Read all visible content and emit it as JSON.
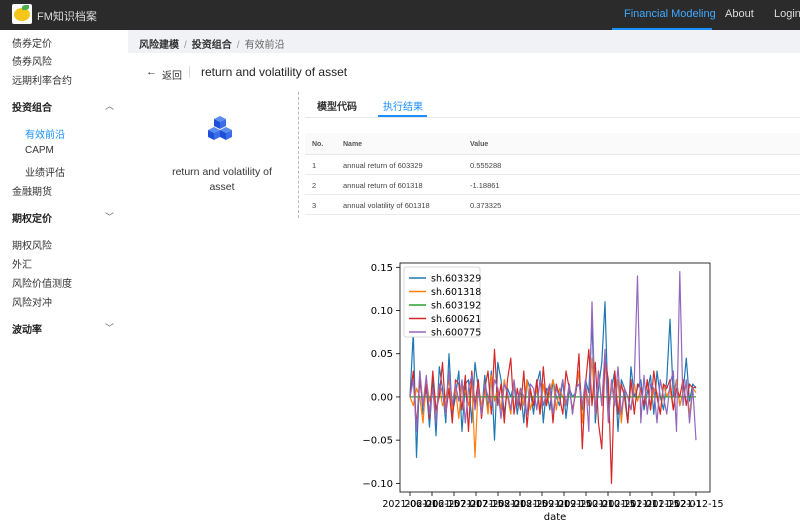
{
  "header": {
    "brand": "FM知识档案",
    "nav": [
      "Financial Modeling",
      "About",
      "Login"
    ],
    "active_nav": "Financial Modeling"
  },
  "sidebar": {
    "items_top": [
      "债券定价",
      "债券风险",
      "远期利率合约"
    ],
    "group_portfolio": "投资组合",
    "portfolio_children": [
      "有效前沿",
      "CAPM",
      "业绩评估"
    ],
    "active_child": "有效前沿",
    "item_futures": "金融期货",
    "group_options": "期权定价",
    "items_mid": [
      "期权风险",
      "外汇",
      "风险价值测度",
      "风险对冲"
    ],
    "group_vol": "波动率"
  },
  "breadcrumb": [
    "风险建模",
    "投资组合",
    "有效前沿"
  ],
  "page": {
    "back_label": "返回",
    "title": "return and volatility of asset",
    "model_name": "return and volatility of asset"
  },
  "tabs": [
    "模型代码",
    "执行结果"
  ],
  "active_tab": "执行结果",
  "table": {
    "headers": [
      "No.",
      "Name",
      "Value"
    ],
    "rows": [
      {
        "no": "1",
        "name": "annual return of 603329",
        "value": "0.555288"
      },
      {
        "no": "2",
        "name": "annual return of 601318",
        "value": "-1.18861"
      },
      {
        "no": "3",
        "name": "annual volatility of 601318",
        "value": "0.373325"
      }
    ]
  },
  "chart_data": {
    "type": "line",
    "xlabel": "date",
    "ylabel": "",
    "x_ticks": [
      "2021-06-01",
      "2021-06-15",
      "2021-07-01",
      "2021-07-15",
      "2021-08-01",
      "2021-08-15",
      "2021-09-01",
      "2021-09-15",
      "2021-10-01",
      "2021-10-15",
      "2021-11-01",
      "2021-11-15",
      "2021-12-01",
      "2021-12-15"
    ],
    "x_tick_labels_visible": [
      "2021-06-01",
      "2021-06-15",
      "2021-07-01",
      "2021-07-15",
      "2021-08-01",
      "2021-08-15",
      "2021-09-01",
      "2021-09-15",
      "2021-10-01",
      "2021-10-15",
      "2021-11-01",
      "2021-11-15",
      "2021-12-01",
      "2021-12-15"
    ],
    "x_tick_labels": [
      "2021-06-01",
      "2021-06-15",
      "2021-07-01",
      "2021-07-15",
      "2021-08-01",
      "2021-08-15",
      "2021-09-01",
      "2021-09-15",
      "2021-10-01",
      "2021-10-15",
      "2021-11-01",
      "2021-11-15",
      "2021-12-01",
      "2021-12-15"
    ],
    "x_ticks_rendered": [
      "2021-06-0",
      "2021-06-1",
      "2021-07-0",
      "2021-07-1",
      "2021-08-0",
      "2021-08-1",
      "2021-09-0",
      "2021-09-1",
      "2021-10-0",
      "2021-10-1",
      "2021-11-0",
      "2021-11-1",
      "2021-12-0",
      "2021-12-1"
    ],
    "x_tick_text": [
      "2021-06-01",
      "2021-06-15",
      "2021-07-01",
      "2021-07-15",
      "2021-08-01",
      "2021-08-15",
      "2021-09-01",
      "2021-09-15",
      "2021-10-01",
      "2021-10-15",
      "2021-11-01",
      "2021-11-15",
      "2021-12-01",
      "2021-12-15"
    ],
    "xtick_labels_shown": [
      "2021-06-01",
      "2021-06-15",
      "2021-07-01",
      "2021-07-15",
      "2021-08-01",
      "2021-08-15",
      "2021-09-01",
      "2021-09-15",
      "2021-10-01",
      "2021-10-15",
      "2021-11-01",
      "2021-11-15",
      "2021-12-01",
      "2021-12-15"
    ],
    "ylim": [
      -0.11,
      0.155
    ],
    "y_ticks": [
      -0.1,
      -0.05,
      0.0,
      0.05,
      0.1,
      0.15
    ],
    "y_tick_labels": [
      "−0.10",
      "−0.05",
      "0.00",
      "0.05",
      "0.10",
      "0.15"
    ],
    "legend_position": "top-left",
    "grid": false,
    "series": [
      {
        "name": "sh.603329",
        "color": "#1f77b4",
        "values": [
          0.0,
          0.075,
          -0.07,
          0.03,
          -0.02,
          0.012,
          -0.035,
          0.02,
          -0.045,
          0.035,
          0.01,
          -0.03,
          0.05,
          -0.02,
          0.0,
          0.03,
          -0.04,
          0.015,
          0.02,
          -0.03,
          0.04,
          0.01,
          -0.02,
          0.025,
          -0.015,
          0.03,
          -0.05,
          0.04,
          0.02,
          -0.02,
          0.01,
          0.0,
          0.015,
          -0.02,
          0.01,
          -0.03,
          0.02,
          0.01,
          -0.02,
          0.015,
          0.03,
          -0.03,
          0.01,
          -0.015,
          0.02,
          0.0,
          -0.01,
          0.02,
          -0.025,
          0.01,
          0.0,
          0.005,
          0.03,
          -0.015,
          0.02,
          0.005,
          0.085,
          -0.03,
          0.01,
          0.04,
          0.11,
          -0.02,
          0.01,
          0.03,
          -0.04,
          0.02,
          0.01,
          -0.03,
          0.035,
          0.0,
          0.01,
          0.02,
          -0.015,
          0.005,
          0.025,
          -0.02,
          0.03,
          0.0,
          -0.015,
          0.02,
          0.09,
          0.0,
          0.02,
          -0.01,
          0.005,
          0.045,
          -0.005,
          0.015,
          0.01
        ]
      },
      {
        "name": "sh.601318",
        "color": "#ff7f0e",
        "values": [
          0.0,
          -0.01,
          0.01,
          0.0,
          -0.03,
          0.02,
          -0.005,
          0.01,
          -0.02,
          0.015,
          -0.01,
          0.0,
          0.02,
          -0.015,
          0.01,
          -0.025,
          0.015,
          0.005,
          -0.01,
          0.02,
          -0.07,
          0.015,
          -0.01,
          0.01,
          -0.02,
          0.025,
          -0.005,
          0.01,
          -0.015,
          0.02,
          0.0,
          -0.02,
          0.015,
          -0.005,
          0.01,
          -0.01,
          0.02,
          -0.015,
          0.0,
          0.01,
          -0.02,
          0.015,
          -0.01,
          0.005,
          0.02,
          -0.015,
          0.01,
          0.0,
          -0.01,
          0.015,
          -0.02,
          0.01,
          0.03,
          -0.03,
          0.015,
          -0.01,
          0.045,
          -0.02,
          0.03,
          -0.01,
          0.05,
          -0.025,
          0.015,
          -0.01,
          0.02,
          -0.03,
          0.01,
          0.0,
          -0.015,
          0.015,
          -0.005,
          0.01,
          -0.01,
          0.02,
          -0.015,
          0.01,
          0.005,
          -0.02,
          0.015,
          0.0,
          0.01,
          -0.015,
          0.02,
          -0.01,
          0.005,
          0.015,
          -0.02,
          0.01,
          0.005
        ]
      },
      {
        "name": "sh.603192",
        "color": "#2ca02c",
        "values": [
          0,
          0,
          0,
          0,
          0,
          0,
          0,
          0,
          0,
          0,
          0,
          0,
          0,
          0,
          0,
          0,
          0,
          0,
          0,
          0,
          0,
          0,
          0,
          0,
          0,
          0,
          0,
          0,
          0,
          0,
          0,
          0,
          0,
          0,
          0,
          0,
          0,
          0,
          0,
          0,
          0,
          0,
          0,
          0,
          0,
          0,
          0,
          0,
          0,
          0,
          0,
          0,
          0,
          0,
          0,
          0,
          0,
          0,
          0,
          0,
          0,
          0,
          0,
          0,
          0,
          0,
          0,
          0,
          0,
          0,
          0,
          0,
          0,
          0,
          0,
          0,
          0,
          0,
          0,
          0,
          0,
          0,
          0,
          0,
          0,
          0,
          0,
          0,
          0
        ]
      },
      {
        "name": "sh.600621",
        "color": "#d62728",
        "values": [
          0.0,
          0.03,
          -0.035,
          0.02,
          -0.01,
          0.015,
          -0.025,
          0.03,
          -0.015,
          0.0,
          0.04,
          -0.02,
          0.01,
          -0.03,
          0.02,
          0.015,
          -0.015,
          0.025,
          -0.04,
          0.03,
          -0.01,
          0.02,
          -0.025,
          0.01,
          0.03,
          -0.02,
          0.055,
          -0.01,
          0.015,
          -0.03,
          0.02,
          0.045,
          -0.02,
          0.01,
          -0.015,
          0.03,
          -0.035,
          0.01,
          -0.01,
          0.02,
          -0.02,
          0.035,
          -0.01,
          0.015,
          -0.03,
          0.015,
          0.0,
          -0.02,
          0.03,
          0.01,
          -0.015,
          0.005,
          0.05,
          -0.06,
          0.015,
          0.055,
          -0.01,
          0.04,
          -0.03,
          -0.06,
          0.045,
          0.02,
          -0.1,
          0.03,
          -0.02,
          0.015,
          0.0,
          -0.03,
          0.02,
          -0.02,
          0.015,
          0.01,
          -0.01,
          0.02,
          -0.015,
          0.03,
          0.0,
          -0.02,
          0.015,
          0.01,
          0.02,
          -0.015,
          0.01,
          0.0,
          0.02,
          -0.01,
          0.015,
          0.01,
          0.012
        ]
      },
      {
        "name": "sh.600775",
        "color": "#9467bd",
        "values": [
          0.0,
          0.02,
          -0.04,
          0.03,
          -0.01,
          0.025,
          -0.02,
          0.01,
          -0.03,
          0.015,
          0.005,
          -0.02,
          0.03,
          -0.01,
          0.015,
          -0.005,
          0.02,
          -0.03,
          0.01,
          0.025,
          -0.015,
          0.01,
          -0.02,
          0.015,
          0.0,
          -0.01,
          0.02,
          0.01,
          -0.025,
          0.015,
          0.005,
          -0.015,
          0.02,
          -0.01,
          0.01,
          0.0,
          -0.02,
          0.015,
          0.01,
          -0.015,
          0.02,
          -0.01,
          0.005,
          0.015,
          -0.02,
          0.01,
          0.0,
          0.02,
          -0.01,
          0.015,
          -0.02,
          0.01,
          0.015,
          -0.01,
          0.02,
          -0.04,
          0.11,
          -0.02,
          0.03,
          -0.01,
          0.055,
          -0.03,
          0.02,
          -0.01,
          0.035,
          -0.02,
          0.01,
          0.0,
          -0.015,
          0.02,
          0.14,
          -0.03,
          0.025,
          -0.02,
          0.015,
          0.01,
          -0.03,
          0.02,
          0.0,
          -0.02,
          0.015,
          0.03,
          -0.04,
          0.145,
          -0.01,
          0.02,
          -0.03,
          0.01,
          -0.05
        ]
      }
    ]
  }
}
